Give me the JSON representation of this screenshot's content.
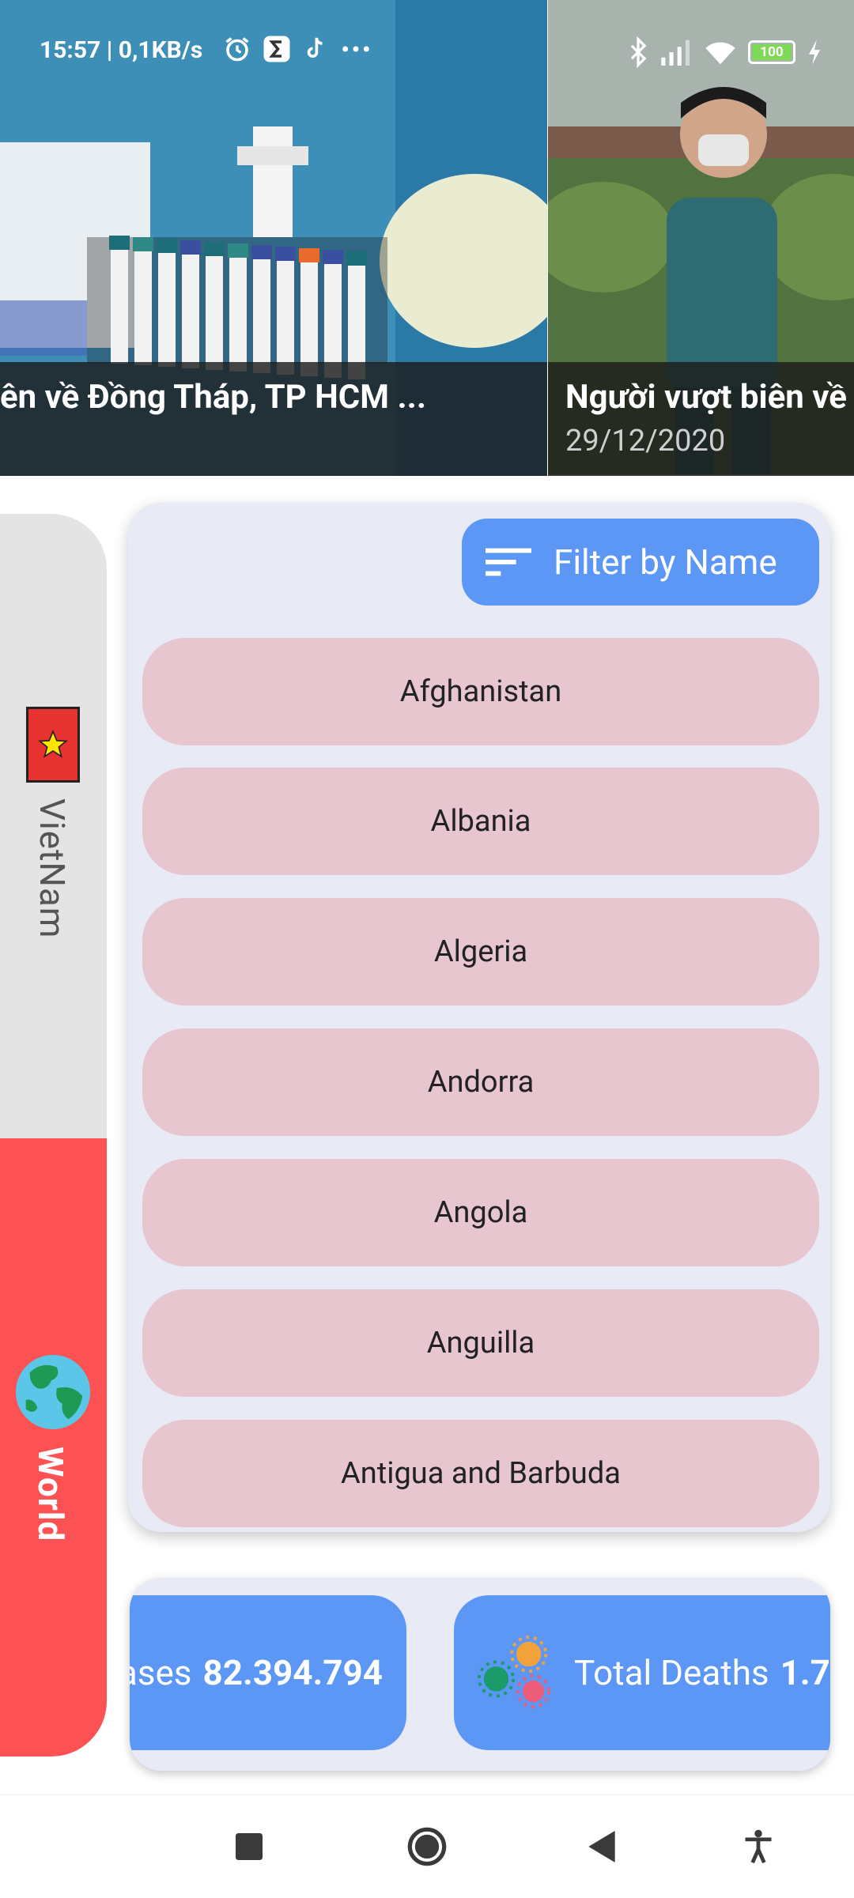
{
  "status_bar": {
    "time": "15:57 | 0,1KB/s",
    "battery": "100",
    "icons": [
      "alarm-icon",
      "sigma-app-icon",
      "tiktok-icon",
      "more-dots-icon",
      "bluetooth-icon",
      "signal-icon",
      "wifi-icon",
      "battery-icon",
      "charging-icon"
    ]
  },
  "news": [
    {
      "title": "ên về Đồng Tháp, TP HCM ...",
      "date": ""
    },
    {
      "title": "Người vượt biên về",
      "date": "29/12/2020"
    }
  ],
  "side_tabs": [
    {
      "label": "VietNam",
      "icon": "vietnam-flag-icon",
      "selected": false
    },
    {
      "label": "World",
      "icon": "globe-icon",
      "selected": true
    }
  ],
  "filter": {
    "label": "Filter by Name",
    "icon": "sort-lines-icon"
  },
  "countries": [
    "Afghanistan",
    "Albania",
    "Algeria",
    "Andorra",
    "Angola",
    "Anguilla",
    "Antigua and Barbuda"
  ],
  "stats": {
    "cases_label": "ases",
    "cases_value": "82.394.794",
    "deaths_label": "Total Deaths",
    "deaths_value": "1.7"
  },
  "colors": {
    "accent_blue": "#5c97f6",
    "world_tab": "#fc5253",
    "country_pill": "#e8c6cf",
    "panel_bg": "#e8eaf6"
  },
  "nav": [
    "recents-square-icon",
    "home-circle-icon",
    "back-triangle-icon",
    "accessibility-icon"
  ]
}
